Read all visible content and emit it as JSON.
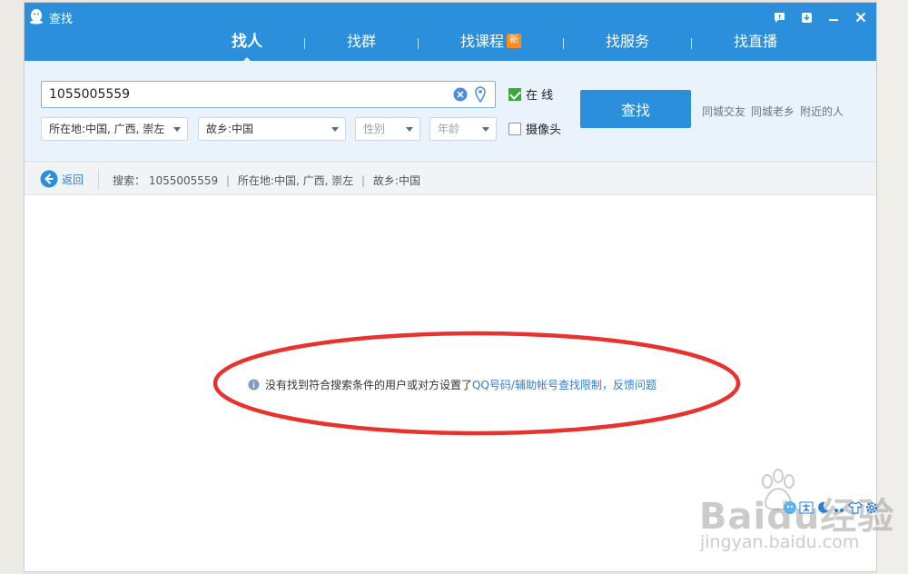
{
  "window": {
    "title": "查找"
  },
  "nav": {
    "items": [
      {
        "label": "找人"
      },
      {
        "label": "找群"
      },
      {
        "label": "找课程",
        "badge": "新"
      },
      {
        "label": "找服务"
      },
      {
        "label": "找直播"
      }
    ],
    "active_index": 0
  },
  "search": {
    "query_value": "1055005559",
    "location_value": "所在地:中国, 广西, 崇左",
    "hometown_value": "故乡:中国",
    "gender_placeholder": "性别",
    "age_placeholder": "年龄",
    "online_label": "在 线",
    "online_checked": true,
    "camera_label": "摄像头",
    "camera_checked": false,
    "find_button": "查找",
    "quick_links": [
      "同城交友",
      "同城老乡",
      "附近的人"
    ]
  },
  "breadcrumb": {
    "back_label": "返回",
    "prefix": "搜索：",
    "query": "1055005559",
    "location": "所在地:中国, 广西, 崇左",
    "hometown": "故乡:中国"
  },
  "result": {
    "message": "没有找到符合搜索条件的用户或对方设置了",
    "link_limit": "QQ号码/辅助帐号查找限制",
    "separator": "，",
    "link_feedback": "反馈问题"
  },
  "watermark": {
    "brand": "Baidu经验",
    "sub": "jingyan.baidu.com"
  },
  "colors": {
    "titlebar": "#2c8fdc",
    "panel": "#eaf2fb",
    "link": "#2c7fd4",
    "annotation": "#e8322e",
    "check_green": "#3aa83a"
  }
}
